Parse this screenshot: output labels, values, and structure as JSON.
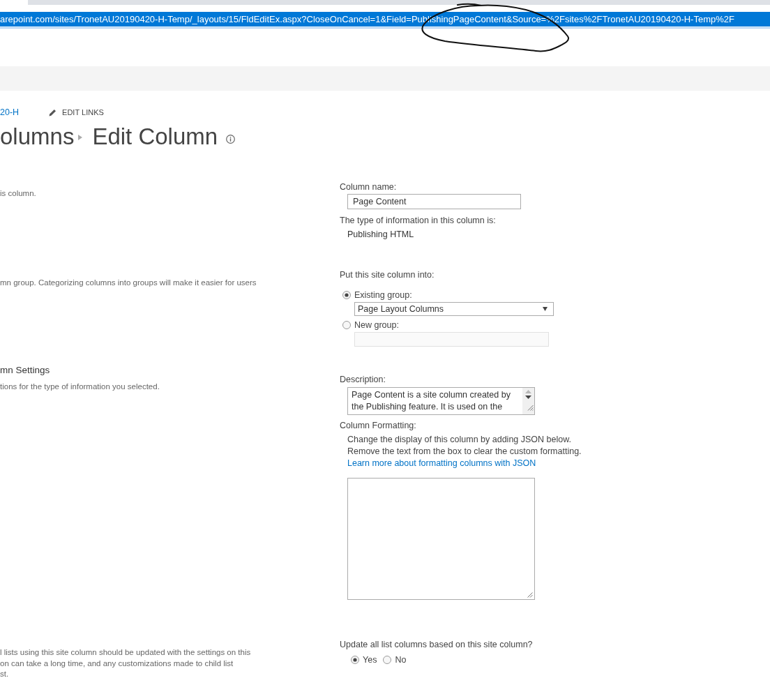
{
  "browser": {
    "address": "arepoint.com/sites/TronetAU20190420-H-Temp/_layouts/15/FldEditEx.aspx?CloseOnCancel=1&Field=PublishingPageContent&Source=%2Fsites%2FTronetAU20190420-H-Temp%2F"
  },
  "breadcrumb": {
    "site_link": "20-H",
    "edit_links": "EDIT LINKS"
  },
  "title": {
    "parent": "olumns",
    "current": "Edit Column"
  },
  "sections": [
    {
      "kind": "name_type",
      "description_lines": [
        "is column."
      ],
      "name_label": "Column name:",
      "name_value": "Page Content",
      "type_label": "The type of information in this column is:",
      "type_value": "Publishing HTML"
    },
    {
      "kind": "group",
      "description_lines": [
        "mn group. Categorizing columns into groups will make it easier for users"
      ],
      "prompt": "Put this site column into:",
      "options": [
        {
          "kind": "select",
          "label": "Existing group:",
          "selected": true,
          "value": "Page Layout Columns"
        },
        {
          "kind": "input",
          "label": "New group:",
          "selected": false
        }
      ]
    },
    {
      "kind": "settings",
      "heading": "mn Settings",
      "description_lines": [
        "tions for the type of information you selected."
      ],
      "description_label": "Description:",
      "description_value": "Page Content is a site column created by the Publishing feature. It is used on the",
      "formatting_label": "Column Formatting:",
      "formatting_help": [
        "Change the display of this column by adding JSON below.",
        "Remove the text from the box to clear the custom formatting."
      ],
      "formatting_link": "Learn more about formatting columns with JSON"
    },
    {
      "kind": "update",
      "description_lines": [
        "l lists using this site column should be updated with the settings on this",
        "on can take a long time, and any customizations made to child list",
        "st."
      ],
      "prompt": "Update all list columns based on this site column?",
      "options": [
        {
          "label": "Yes",
          "selected": true
        },
        {
          "label": "No",
          "selected": false
        }
      ]
    }
  ]
}
